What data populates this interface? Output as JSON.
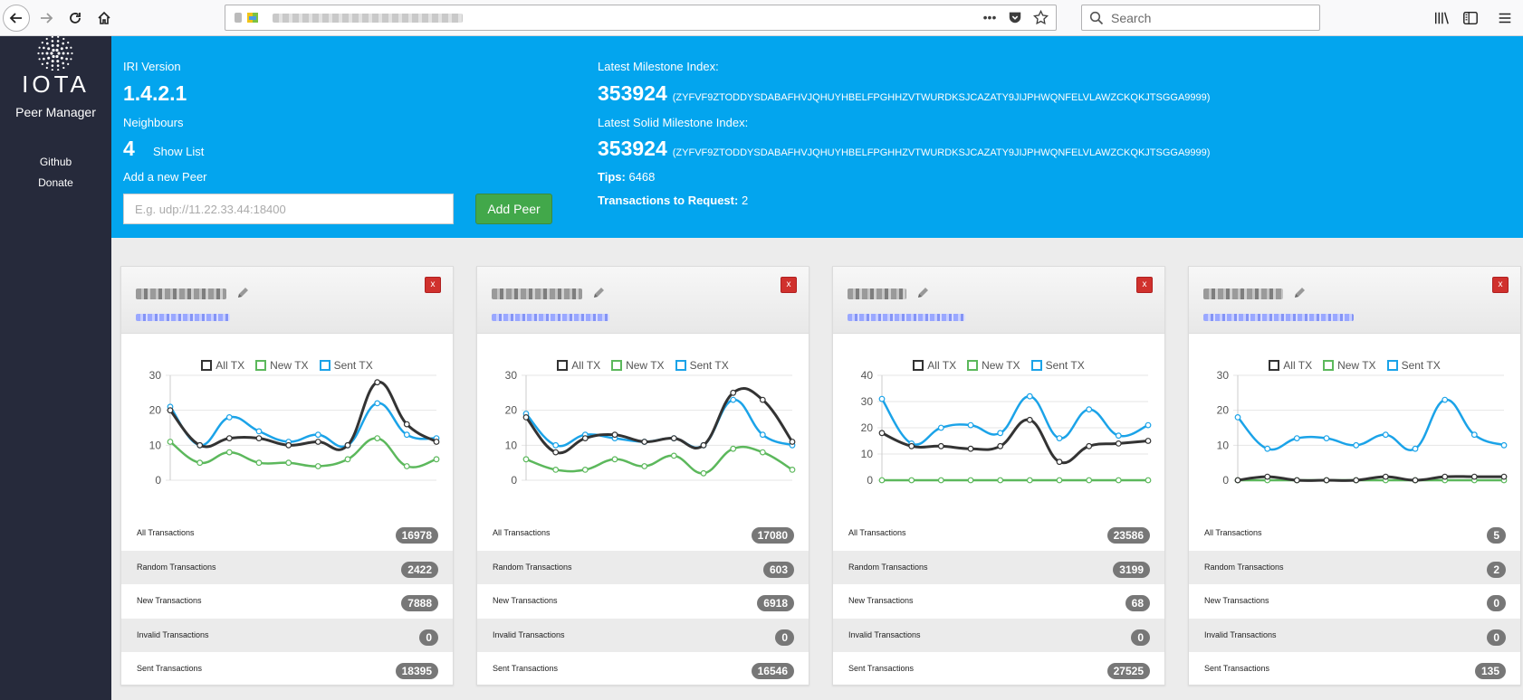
{
  "browser": {
    "search_placeholder": "Search"
  },
  "sidebar": {
    "logo_text": "IOTA",
    "app_name": "Peer Manager",
    "links": [
      "Github",
      "Donate"
    ]
  },
  "header": {
    "iri_label": "IRI Version",
    "iri_version": "1.4.2.1",
    "neighbours_label": "Neighbours",
    "neighbours_count": "4",
    "show_list": "Show List",
    "add_peer_label": "Add a new Peer",
    "peer_placeholder": "E.g. udp://11.22.33.44:18400",
    "add_peer_button": "Add Peer",
    "milestone_label": "Latest Milestone Index:",
    "milestone_index": "353924",
    "milestone_hash": "(ZYFVF9ZTODDYSDABAFHVJQHUYHBELFPGHHZVTWURDKSJCAZATY9JIJPHWQNFELVLAWZCKQKJTSGGA9999)",
    "solid_label": "Latest Solid Milestone Index:",
    "solid_index": "353924",
    "solid_hash": "(ZYFVF9ZTODDYSDABAFHVJQHUYHBELFPGHHZVTWURDKSJCAZATY9JIJPHWQNFELVLAWZCKQKJTSGGA9999)",
    "tips_label": "Tips:",
    "tips_value": "6468",
    "tx_request_label": "Transactions to Request:",
    "tx_request_value": "2"
  },
  "legend": [
    "All TX",
    "New TX",
    "Sent TX"
  ],
  "colors": {
    "all": "#333333",
    "new": "#5cb85c",
    "sent": "#1ba3e8",
    "header": "#03a5ee",
    "sidebar": "#262a3b"
  },
  "stat_labels": [
    "All Transactions",
    "Random Transactions",
    "New Transactions",
    "Invalid Transactions",
    "Sent Transactions"
  ],
  "cards": [
    {
      "close": "x",
      "stats": [
        "16978",
        "2422",
        "7888",
        "0",
        "18395"
      ]
    },
    {
      "close": "x",
      "stats": [
        "17080",
        "603",
        "6918",
        "0",
        "16546"
      ]
    },
    {
      "close": "x",
      "stats": [
        "23586",
        "3199",
        "68",
        "0",
        "27525"
      ]
    },
    {
      "close": "x",
      "stats": [
        "5",
        "2",
        "0",
        "0",
        "135"
      ]
    }
  ],
  "chart_data": [
    {
      "type": "line",
      "ylim": [
        0,
        30
      ],
      "yticks": [
        0,
        10,
        20,
        30
      ],
      "series": [
        {
          "name": "All TX",
          "values": [
            20,
            10,
            12,
            12,
            10,
            11,
            10,
            28,
            16,
            11
          ]
        },
        {
          "name": "New TX",
          "values": [
            11,
            5,
            8,
            5,
            5,
            4,
            6,
            12,
            4,
            6
          ]
        },
        {
          "name": "Sent TX",
          "values": [
            21,
            10,
            18,
            14,
            11,
            13,
            10,
            22,
            13,
            12
          ]
        }
      ]
    },
    {
      "type": "line",
      "ylim": [
        0,
        30
      ],
      "yticks": [
        0,
        10,
        20,
        30
      ],
      "series": [
        {
          "name": "All TX",
          "values": [
            18,
            8,
            12,
            13,
            11,
            12,
            10,
            25,
            23,
            11
          ]
        },
        {
          "name": "New TX",
          "values": [
            6,
            3,
            3,
            6,
            4,
            7,
            2,
            9,
            8,
            3
          ]
        },
        {
          "name": "Sent TX",
          "values": [
            19,
            10,
            13,
            12,
            11,
            12,
            10,
            23,
            13,
            10
          ]
        }
      ]
    },
    {
      "type": "line",
      "ylim": [
        0,
        40
      ],
      "yticks": [
        0,
        10,
        20,
        30,
        40
      ],
      "series": [
        {
          "name": "All TX",
          "values": [
            18,
            13,
            13,
            12,
            13,
            23,
            7,
            13,
            14,
            15
          ]
        },
        {
          "name": "New TX",
          "values": [
            0,
            0,
            0,
            0,
            0,
            0,
            0,
            0,
            0,
            0
          ]
        },
        {
          "name": "Sent TX",
          "values": [
            31,
            14,
            20,
            21,
            18,
            32,
            16,
            27,
            17,
            21
          ]
        }
      ]
    },
    {
      "type": "line",
      "ylim": [
        0,
        30
      ],
      "yticks": [
        0,
        10,
        20,
        30
      ],
      "series": [
        {
          "name": "All TX",
          "values": [
            0,
            1,
            0,
            0,
            0,
            1,
            0,
            1,
            1,
            1
          ]
        },
        {
          "name": "New TX",
          "values": [
            0,
            0,
            0,
            0,
            0,
            0,
            0,
            0,
            0,
            0
          ]
        },
        {
          "name": "Sent TX",
          "values": [
            18,
            9,
            12,
            12,
            10,
            13,
            9,
            23,
            13,
            10
          ]
        }
      ]
    }
  ]
}
